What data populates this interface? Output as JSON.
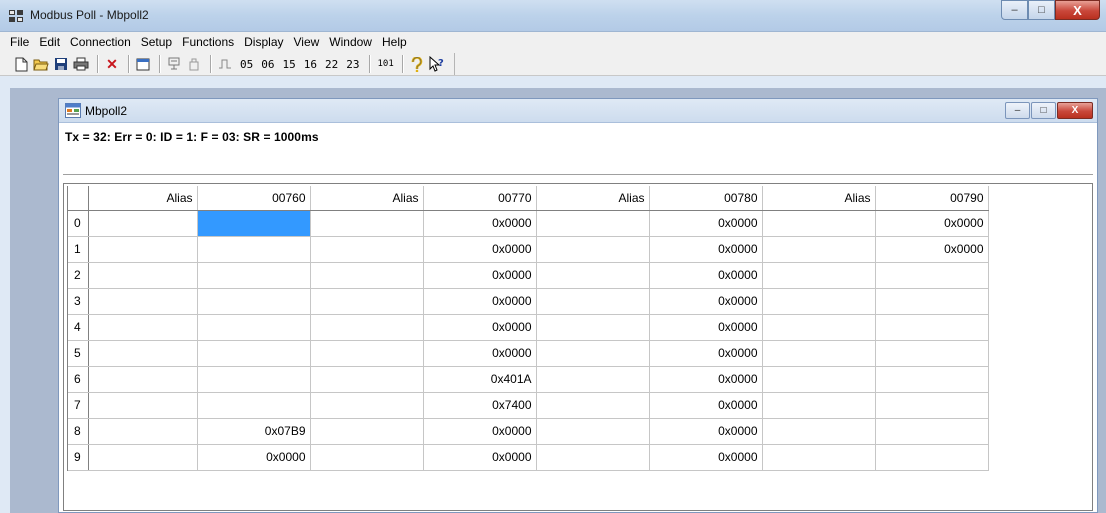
{
  "window": {
    "title": "Modbus Poll - Mbpoll2",
    "minimize": "–",
    "maximize": "□",
    "close": "X"
  },
  "menu": [
    "File",
    "Edit",
    "Connection",
    "Setup",
    "Functions",
    "Display",
    "View",
    "Window",
    "Help"
  ],
  "toolbar": {
    "function_codes": [
      "05",
      "06",
      "15",
      "16",
      "22",
      "23"
    ],
    "extra_code": "101"
  },
  "child": {
    "title": "Mbpoll2",
    "status": "Tx = 32: Err = 0: ID = 1: F = 03: SR = 1000ms"
  },
  "grid": {
    "headers": [
      "Alias",
      "00760",
      "Alias",
      "00770",
      "Alias",
      "00780",
      "Alias",
      "00790"
    ],
    "rows": [
      {
        "index": "0",
        "cells": [
          "",
          "",
          "",
          "0x0000",
          "",
          "0x0000",
          "",
          "0x0000"
        ]
      },
      {
        "index": "1",
        "cells": [
          "",
          "",
          "",
          "0x0000",
          "",
          "0x0000",
          "",
          "0x0000"
        ]
      },
      {
        "index": "2",
        "cells": [
          "",
          "",
          "",
          "0x0000",
          "",
          "0x0000",
          "",
          ""
        ]
      },
      {
        "index": "3",
        "cells": [
          "",
          "",
          "",
          "0x0000",
          "",
          "0x0000",
          "",
          ""
        ]
      },
      {
        "index": "4",
        "cells": [
          "",
          "",
          "",
          "0x0000",
          "",
          "0x0000",
          "",
          ""
        ]
      },
      {
        "index": "5",
        "cells": [
          "",
          "",
          "",
          "0x0000",
          "",
          "0x0000",
          "",
          ""
        ]
      },
      {
        "index": "6",
        "cells": [
          "",
          "",
          "",
          "0x401A",
          "",
          "0x0000",
          "",
          ""
        ]
      },
      {
        "index": "7",
        "cells": [
          "",
          "",
          "",
          "0x7400",
          "",
          "0x0000",
          "",
          ""
        ]
      },
      {
        "index": "8",
        "cells": [
          "",
          "0x07B9",
          "",
          "0x0000",
          "",
          "0x0000",
          "",
          ""
        ]
      },
      {
        "index": "9",
        "cells": [
          "",
          "0x0000",
          "",
          "0x0000",
          "",
          "0x0000",
          "",
          ""
        ]
      }
    ],
    "selected_cell": {
      "row": 0,
      "col": 1
    },
    "selection_color": "#3399ff"
  }
}
